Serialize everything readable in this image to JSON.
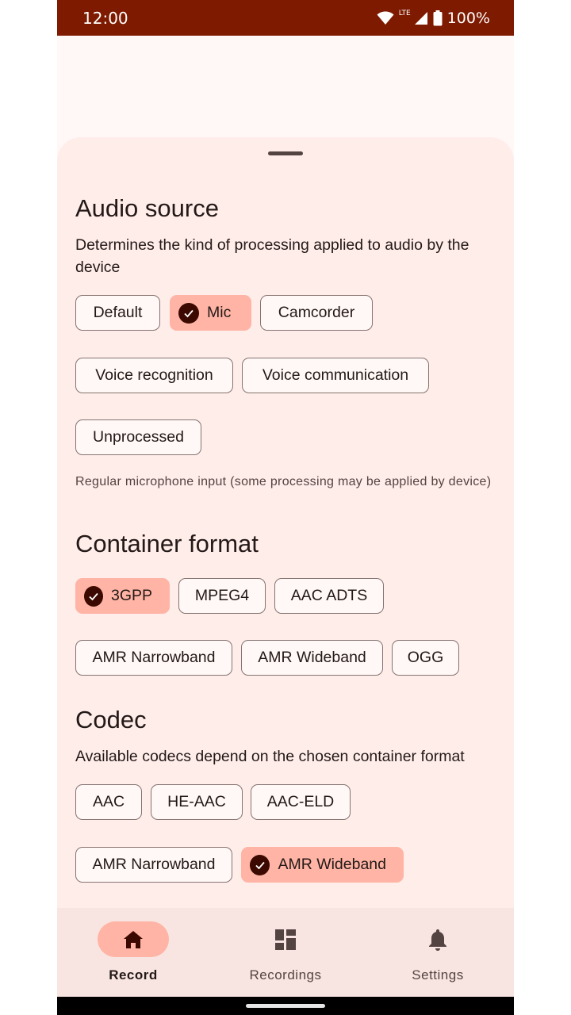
{
  "status_bar": {
    "time": "12:00",
    "network": "LTE",
    "battery": "100%"
  },
  "audio_source": {
    "title": "Audio source",
    "description": "Determines the kind of processing applied to audio by the device",
    "chips": [
      "Default",
      "Mic",
      "Camcorder",
      "Voice recognition",
      "Voice communication",
      "Unprocessed"
    ],
    "selected": "Mic",
    "note": "Regular microphone input (some processing may be applied by device)"
  },
  "container_format": {
    "title": "Container format",
    "chips": [
      "3GPP",
      "MPEG4",
      "AAC ADTS",
      "AMR Narrowband",
      "AMR Wideband",
      "OGG"
    ],
    "selected": "3GPP"
  },
  "codec": {
    "title": "Codec",
    "description": "Available codecs depend on the chosen container format",
    "chips": [
      "AAC",
      "HE-AAC",
      "AAC-ELD",
      "AMR Narrowband",
      "AMR Wideband"
    ],
    "selected": "AMR Wideband"
  },
  "nav": {
    "items": [
      {
        "label": "Record",
        "icon": "home-icon",
        "active": true
      },
      {
        "label": "Recordings",
        "icon": "dashboard-icon",
        "active": false
      },
      {
        "label": "Settings",
        "icon": "bell-icon",
        "active": false
      }
    ]
  },
  "colors": {
    "status_bar": "#7d1a00",
    "sheet": "#ffedea",
    "chip_selected": "#ffb4a5",
    "nav_bar": "#f8e5e1"
  }
}
